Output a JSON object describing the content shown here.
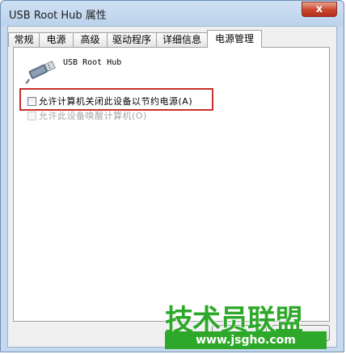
{
  "window": {
    "title": "USB Root Hub 属性",
    "close_glyph": "x"
  },
  "tabs": [
    {
      "label": "常规"
    },
    {
      "label": "电源"
    },
    {
      "label": "高级"
    },
    {
      "label": "驱动程序"
    },
    {
      "label": "详细信息"
    },
    {
      "label": "电源管理",
      "active": true
    }
  ],
  "device": {
    "name": "USB Root Hub",
    "icon": "usb-plug-icon"
  },
  "options": [
    {
      "label": "允许计算机关闭此设备以节约电源(A)",
      "checked": false,
      "enabled": true
    },
    {
      "label": "允许此设备唤醒计算机(O)",
      "checked": false,
      "enabled": false
    }
  ],
  "watermark": {
    "logo_text": "技术员联盟",
    "url": "www.jsgho.com",
    "color": "#2ea82a"
  },
  "colors": {
    "highlight": "#c8302b",
    "close": "#c9462b"
  }
}
